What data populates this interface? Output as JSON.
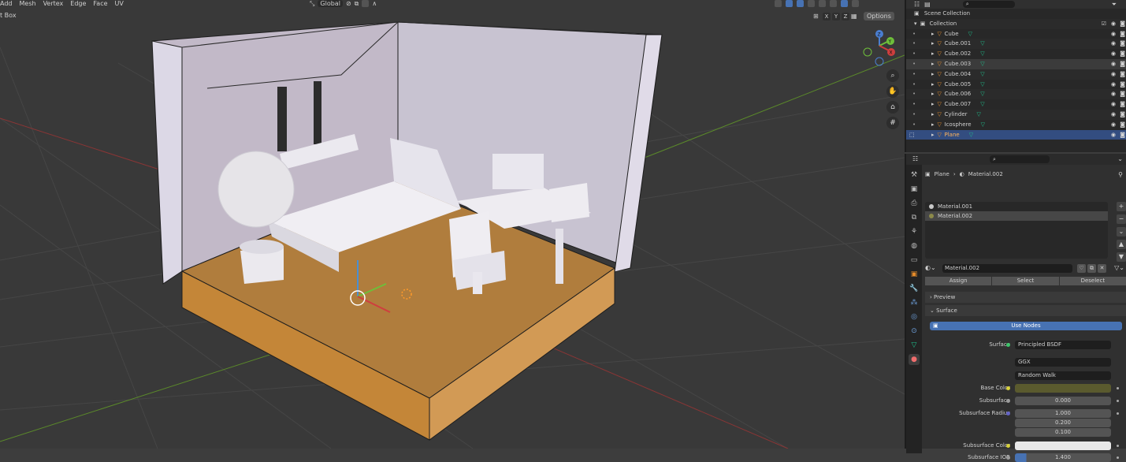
{
  "viewport": {
    "menu": [
      "Add",
      "Mesh",
      "Vertex",
      "Edge",
      "Face",
      "UV"
    ],
    "subheader_label": "t Box",
    "orientation": "Global",
    "axes": [
      "X",
      "Y",
      "Z"
    ],
    "options_label": "Options",
    "gizmo_labels": {
      "z": "Z",
      "y": "Y",
      "x": "X"
    }
  },
  "outliner": {
    "root": "Scene Collection",
    "collection": "Collection",
    "items": [
      {
        "name": "Cube"
      },
      {
        "name": "Cube.001"
      },
      {
        "name": "Cube.002"
      },
      {
        "name": "Cube.003"
      },
      {
        "name": "Cube.004"
      },
      {
        "name": "Cube.005"
      },
      {
        "name": "Cube.006"
      },
      {
        "name": "Cube.007"
      },
      {
        "name": "Cylinder"
      },
      {
        "name": "Icosphere"
      },
      {
        "name": "Plane"
      }
    ]
  },
  "properties": {
    "breadcrumb": {
      "object": "Plane",
      "material": "Material.002"
    },
    "slots": [
      "Material.001",
      "Material.002"
    ],
    "material_name": "Material.002",
    "buttons": {
      "assign": "Assign",
      "select": "Select",
      "deselect": "Deselect"
    },
    "panels": {
      "preview": "Preview",
      "surface": "Surface"
    },
    "use_nodes": "Use Nodes",
    "surface_label": "Surface",
    "surface_value": "Principled BSDF",
    "distribution": "GGX",
    "subsurface_method": "Random Walk",
    "base_color_label": "Base Color",
    "base_color": "#5a5a2e",
    "subsurface_label": "Subsurface",
    "subsurface_value": "0.000",
    "subsurface_radius_label": "Subsurface Radius",
    "subsurface_radius": [
      "1.000",
      "0.200",
      "0.100"
    ],
    "subsurface_color_label": "Subsurface Color",
    "subsurface_color": "#e8e8e8",
    "subsurface_ior_label": "Subsurface IOR",
    "subsurface_ior": "1.400"
  }
}
